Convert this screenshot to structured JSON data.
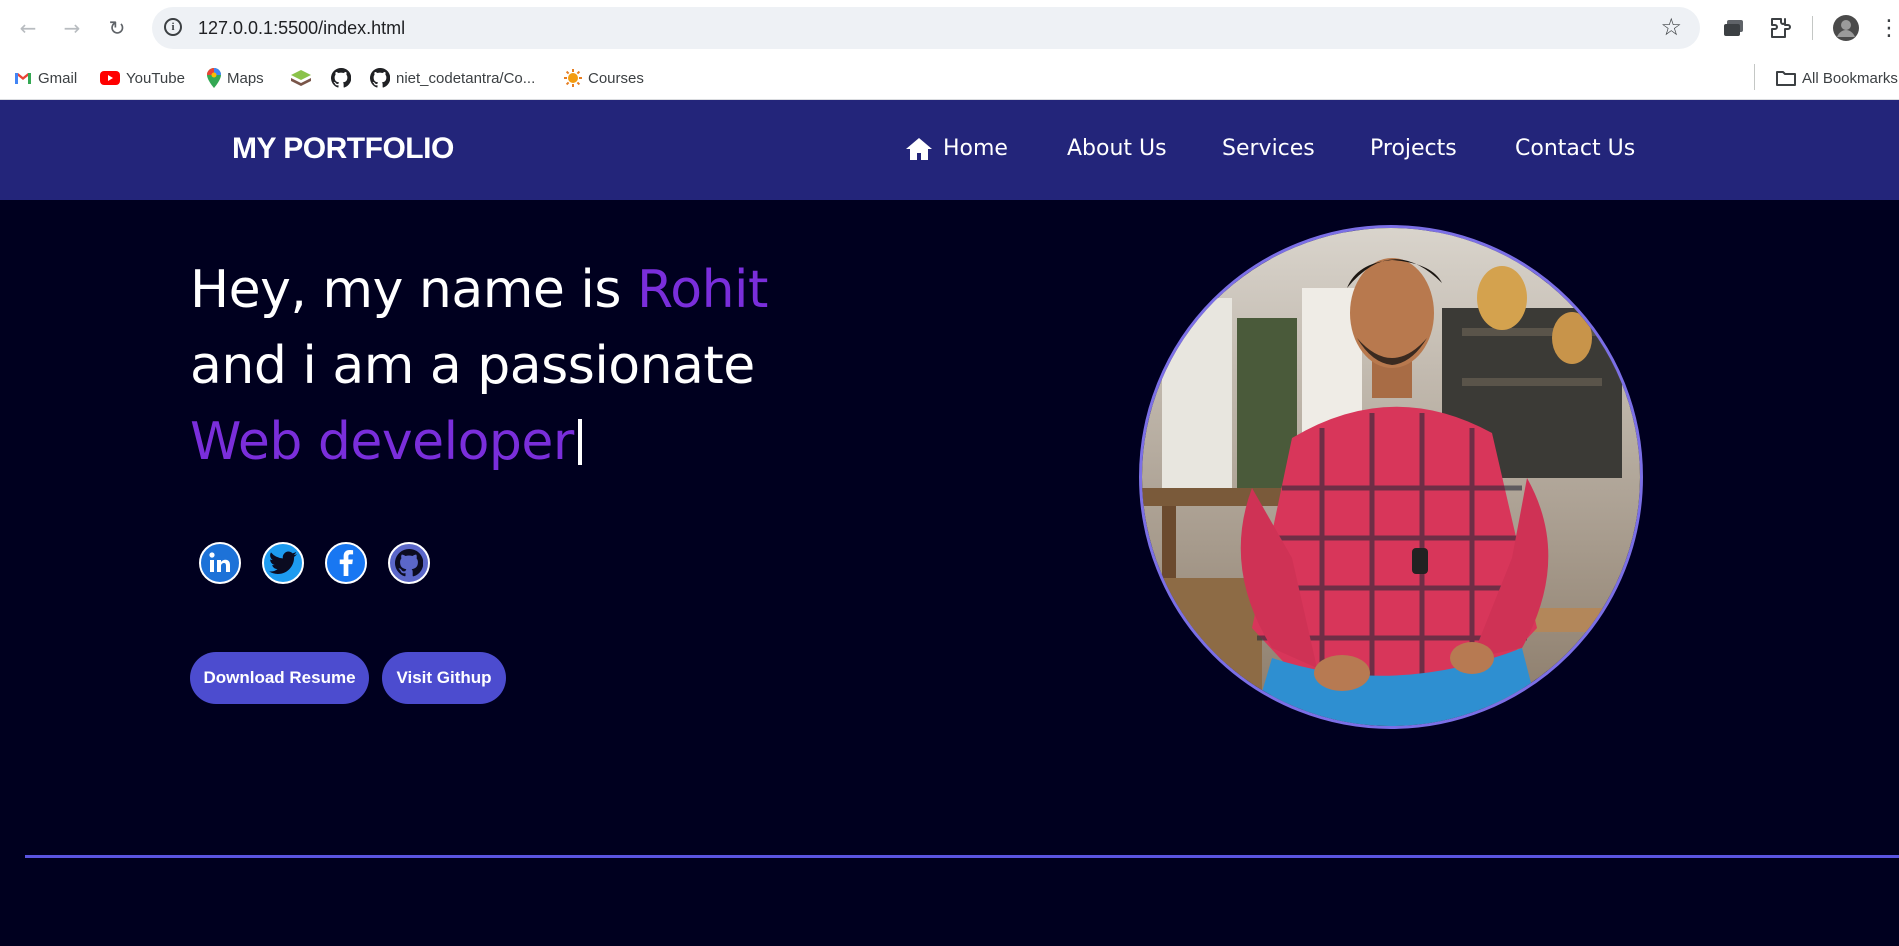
{
  "browser": {
    "url": "127.0.0.1:5500/index.html",
    "bookmarks": [
      {
        "label": "Gmail",
        "icon": "gmail-icon"
      },
      {
        "label": "YouTube",
        "icon": "youtube-icon"
      },
      {
        "label": "Maps",
        "icon": "maps-icon"
      },
      {
        "label": "",
        "icon": "layers-icon"
      },
      {
        "label": "",
        "icon": "github-icon"
      },
      {
        "label": "niet_codetantra/Co...",
        "icon": "github-icon"
      },
      {
        "label": "Courses",
        "icon": "courses-icon"
      }
    ],
    "all_bookmarks_label": "All Bookmarks"
  },
  "header": {
    "logo": "MY PORTFOLIO",
    "nav": [
      "Home",
      "About Us",
      "Services",
      "Projects",
      "Contact Us"
    ]
  },
  "hero": {
    "line1_prefix": "Hey, my name is ",
    "name": "Rohit",
    "line2": "and i am a passionate",
    "role": "Web developer",
    "social_icons": [
      "linkedin-icon",
      "twitter-icon",
      "facebook-icon",
      "github-icon"
    ],
    "buttons": {
      "resume": "Download Resume",
      "github": "Visit Githup"
    }
  },
  "colors": {
    "header_bg": "#23257a",
    "page_bg": "#00001f",
    "accent": "#7a2edb",
    "button": "#4c4ccf",
    "divider": "#5a54e0"
  }
}
